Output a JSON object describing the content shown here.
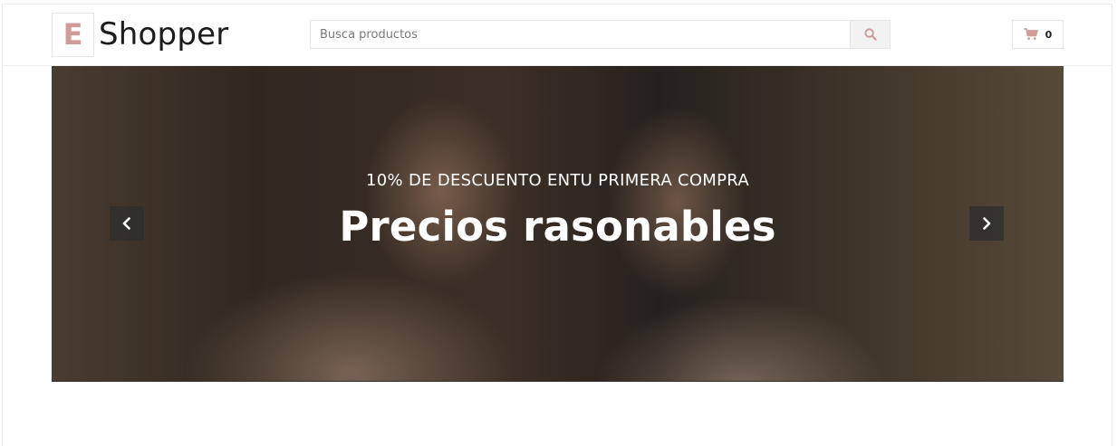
{
  "header": {
    "logo_letter": "E",
    "logo_text": "Shopper",
    "search": {
      "placeholder": "Busca productos"
    },
    "cart": {
      "count": "0"
    }
  },
  "hero": {
    "subtitle": "10% DE DESCUENTO ENTU PRIMERA COMPRA",
    "title": "Precios rasonables"
  },
  "colors": {
    "accent": "#d19c97",
    "text_dark": "#1c1c1c",
    "border": "#e6e6e6"
  },
  "icons": {
    "search": "search-icon",
    "cart": "shopping-cart-icon",
    "prev": "chevron-left-icon",
    "next": "chevron-right-icon"
  }
}
